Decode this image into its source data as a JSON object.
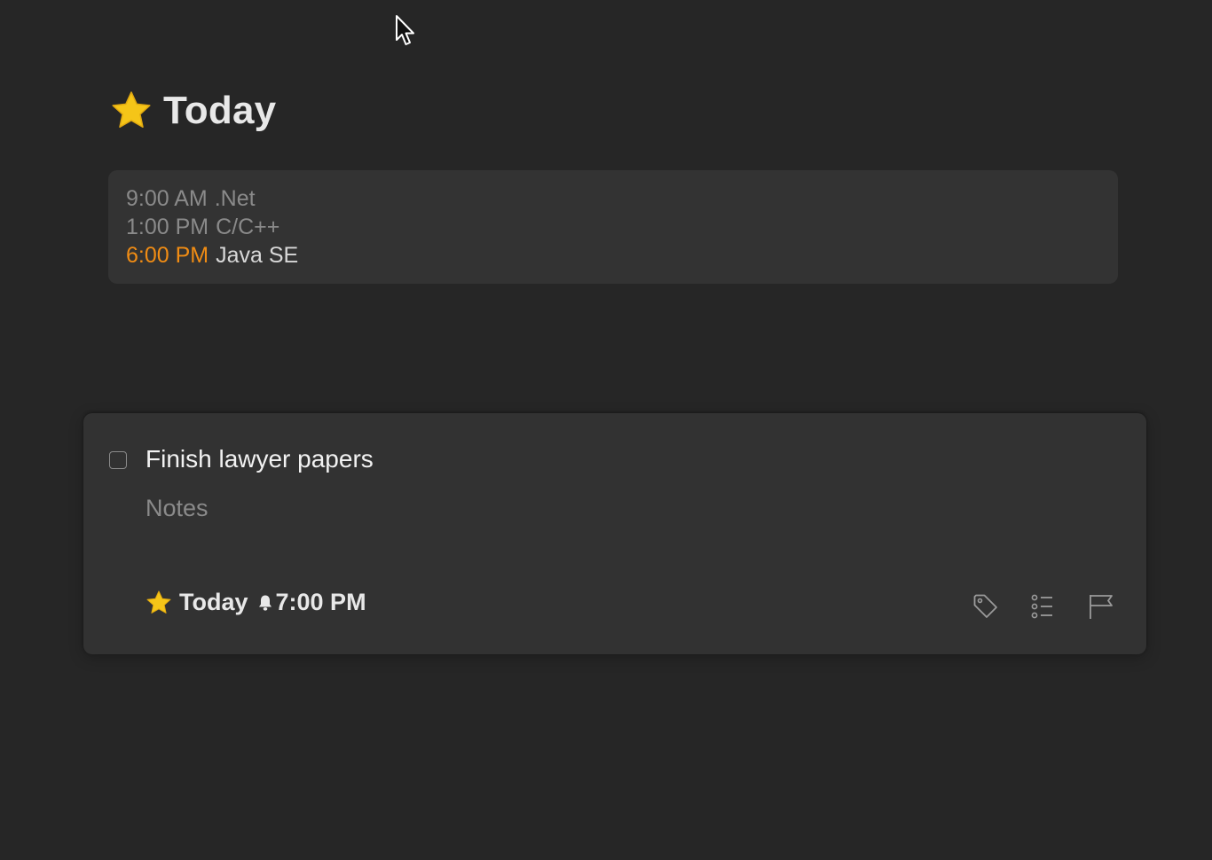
{
  "header": {
    "title": "Today",
    "icon": "star-icon"
  },
  "calendar": {
    "events": [
      {
        "time": "9:00 AM",
        "name": ".Net",
        "state": "past"
      },
      {
        "time": "1:00 PM",
        "name": "C/C++",
        "state": "past"
      },
      {
        "time": "6:00 PM",
        "name": "Java SE",
        "state": "current"
      }
    ]
  },
  "task": {
    "title": "Finish lawyer papers",
    "notes_placeholder": "Notes",
    "completed": false,
    "when_label": "Today",
    "reminder_time": "7:00 PM",
    "tools": [
      "tag-icon",
      "checklist-icon",
      "flag-icon"
    ]
  },
  "colors": {
    "background": "#262626",
    "card": "#323232",
    "accent_star": "#f5c518",
    "current_event": "#f08c14"
  }
}
